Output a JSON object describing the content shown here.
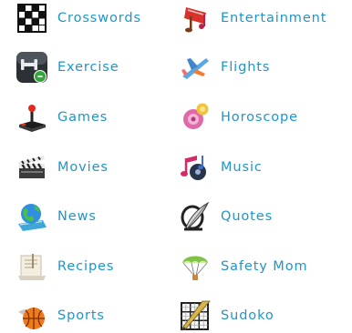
{
  "categories": [
    {
      "label": "Crosswords",
      "icon": "crossword-grid-icon"
    },
    {
      "label": "Entertainment",
      "icon": "entertainment-icon"
    },
    {
      "label": "Exercise",
      "icon": "exercise-icon"
    },
    {
      "label": "Flights",
      "icon": "airplane-icon"
    },
    {
      "label": "Games",
      "icon": "joystick-icon"
    },
    {
      "label": "Horoscope",
      "icon": "horoscope-icon"
    },
    {
      "label": "Movies",
      "icon": "clapperboard-icon"
    },
    {
      "label": "Music",
      "icon": "music-notes-icon"
    },
    {
      "label": "News",
      "icon": "globe-news-icon"
    },
    {
      "label": "Quotes",
      "icon": "quill-pen-icon"
    },
    {
      "label": "Recipes",
      "icon": "recipe-card-icon"
    },
    {
      "label": "Safety Mom",
      "icon": "parachute-icon"
    },
    {
      "label": "Sports",
      "icon": "basketball-icon"
    },
    {
      "label": "Sudoko",
      "icon": "sudoku-grid-icon"
    }
  ],
  "colors": {
    "link": "#1f95c9"
  }
}
